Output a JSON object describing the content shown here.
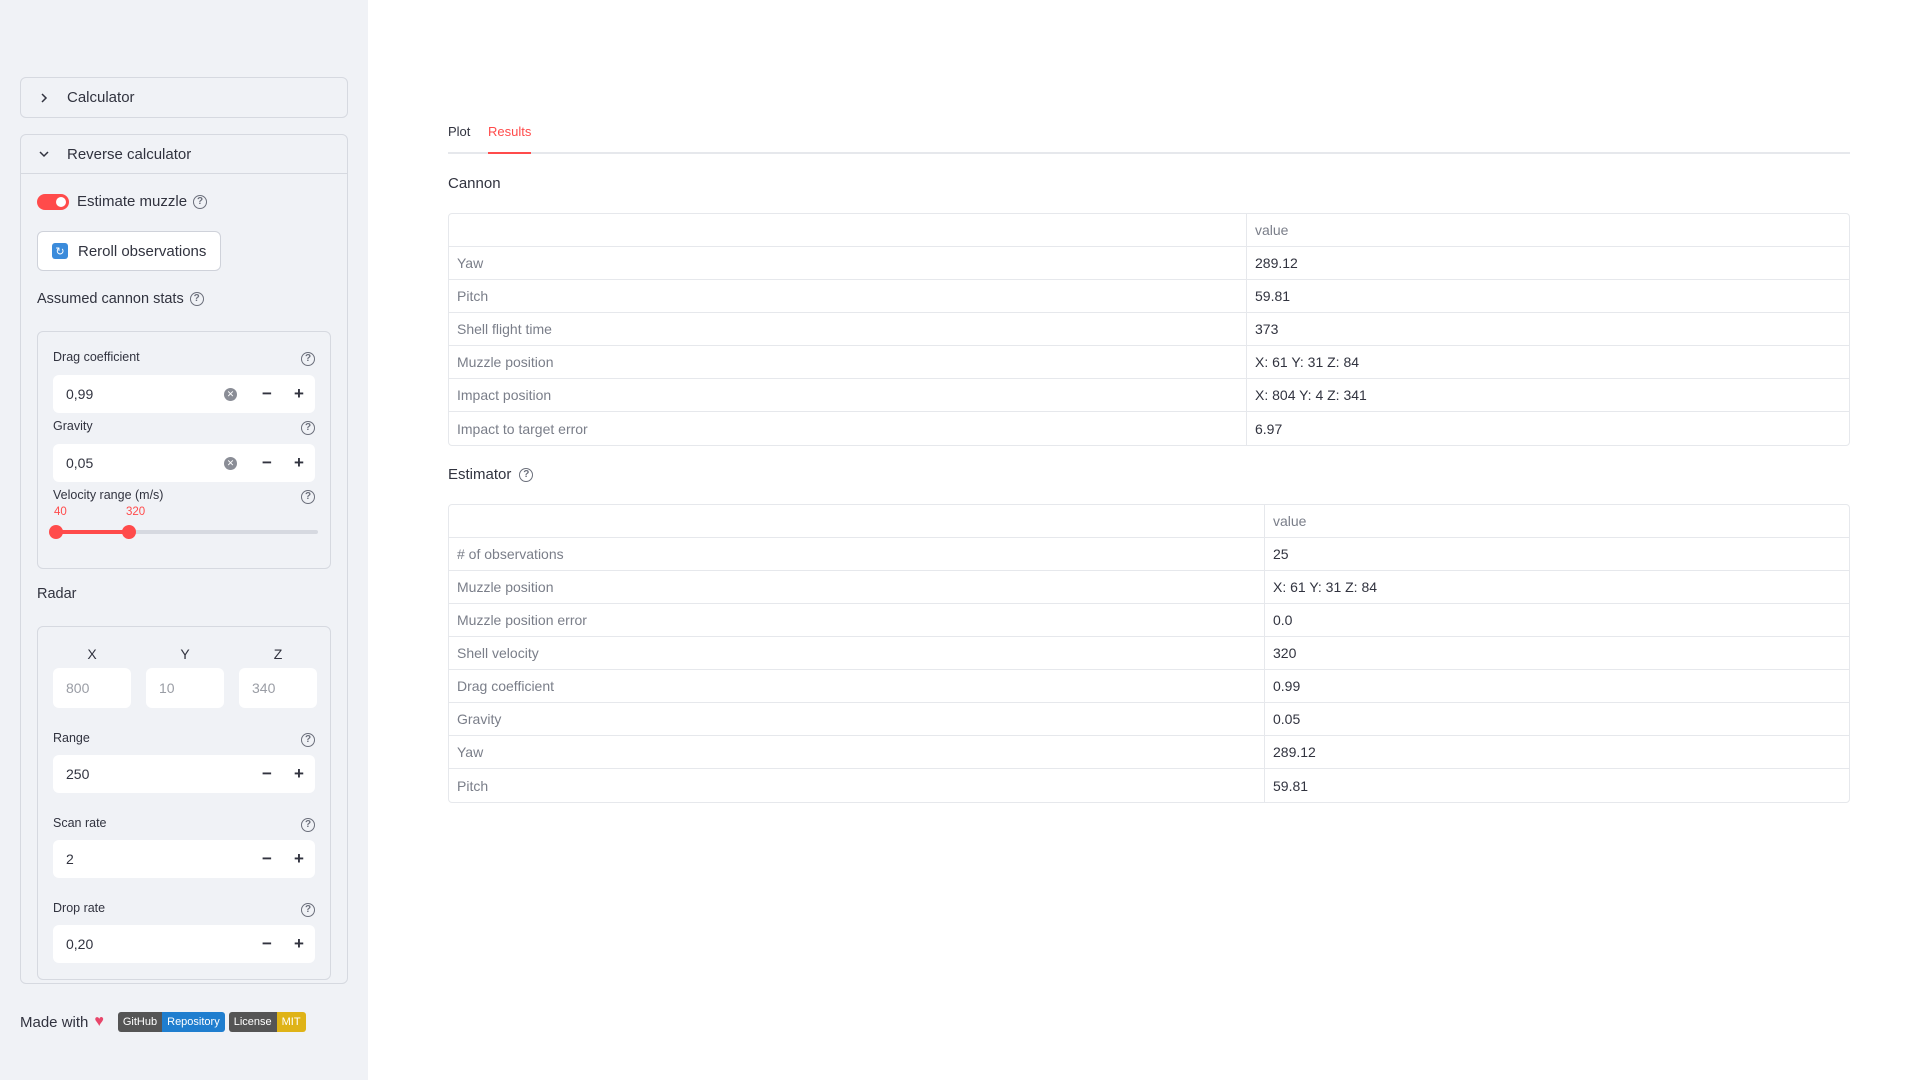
{
  "sidebar": {
    "calculator_label": "Calculator",
    "reverse_label": "Reverse calculator",
    "toggle_label": "Estimate muzzle",
    "reroll_label": "Reroll observations",
    "assumed_label": "Assumed cannon stats",
    "drag": {
      "label": "Drag coefficient",
      "value": "0,99"
    },
    "gravity": {
      "label": "Gravity",
      "value": "0,05"
    },
    "velocity": {
      "label": "Velocity range (m/s)",
      "min": "40",
      "max": "320",
      "range_fraction": [
        0,
        0.28
      ]
    },
    "radar_label": "Radar",
    "x": {
      "label": "X",
      "placeholder": "800"
    },
    "y": {
      "label": "Y",
      "placeholder": "10"
    },
    "z": {
      "label": "Z",
      "placeholder": "340"
    },
    "range": {
      "label": "Range",
      "value": "250"
    },
    "scan_rate": {
      "label": "Scan rate",
      "value": "2"
    },
    "drop_rate": {
      "label": "Drop rate",
      "value": "0,20"
    },
    "footer": {
      "made_with": "Made with",
      "badge1_left": "GitHub",
      "badge1_right": "Repository",
      "badge2_left": "License",
      "badge2_right": "MIT"
    }
  },
  "tabs": {
    "plot": "Plot",
    "results": "Results"
  },
  "cannon": {
    "heading": "Cannon",
    "col_header": "value",
    "rows": [
      {
        "key": "Yaw",
        "value": "289.12"
      },
      {
        "key": "Pitch",
        "value": "59.81"
      },
      {
        "key": "Shell flight time",
        "value": "373"
      },
      {
        "key": "Muzzle position",
        "value": "X: 61 Y: 31 Z: 84"
      },
      {
        "key": "Impact position",
        "value": "X: 804 Y: 4 Z: 341"
      },
      {
        "key": "Impact to target error",
        "value": "6.97"
      }
    ]
  },
  "estimator": {
    "heading": "Estimator",
    "col_header": "value",
    "rows": [
      {
        "key": "# of observations",
        "value": "25"
      },
      {
        "key": "Muzzle position",
        "value": "X: 61 Y: 31 Z: 84"
      },
      {
        "key": "Muzzle position error",
        "value": "0.0"
      },
      {
        "key": "Shell velocity",
        "value": "320"
      },
      {
        "key": "Drag coefficient",
        "value": "0.99"
      },
      {
        "key": "Gravity",
        "value": "0.05"
      },
      {
        "key": "Yaw",
        "value": "289.12"
      },
      {
        "key": "Pitch",
        "value": "59.81"
      }
    ]
  },
  "colors": {
    "accent": "#ff4b4b",
    "sidebar_bg": "#f0f2f6"
  }
}
